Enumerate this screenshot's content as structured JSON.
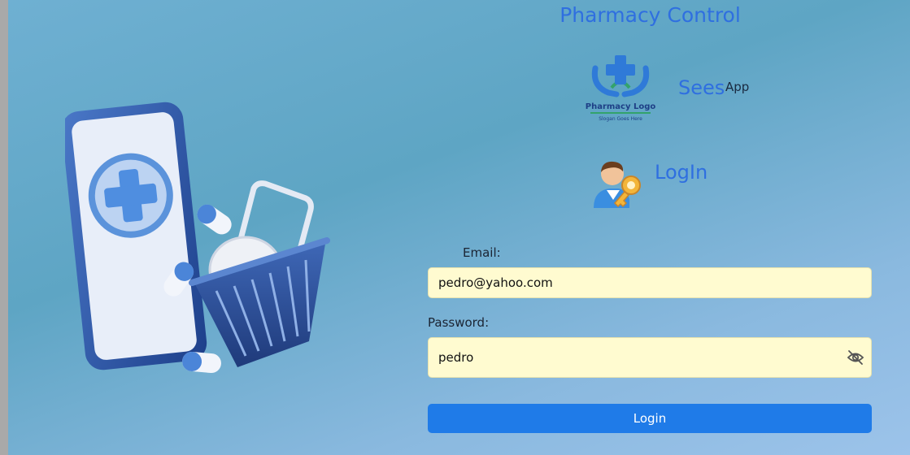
{
  "header": {
    "title": "Pharmacy Control"
  },
  "brand": {
    "logo_text": "Pharmacy Logo",
    "logo_slogan": "Slogan Goes Here",
    "name_main": "Sees",
    "name_sup": "App"
  },
  "login": {
    "heading": "LogIn",
    "email_label": "Email:",
    "email_value": "pedro@yahoo.com",
    "password_label": "Password:",
    "password_value": "pedro",
    "button_label": "Login"
  },
  "colors": {
    "accent": "#2f6fe0",
    "button": "#1f7be8",
    "input_bg": "#fffbd0"
  },
  "icons": {
    "logo": "pharmacy-cross-hands-icon",
    "login": "user-key-icon",
    "password_toggle": "eye-slash-icon"
  }
}
